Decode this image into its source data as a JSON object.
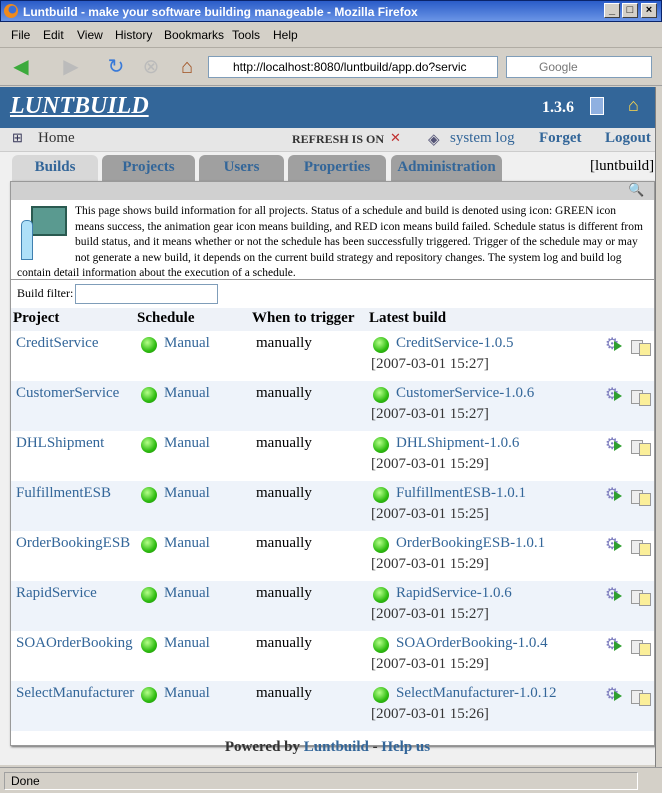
{
  "window": {
    "title": "Luntbuild - make your software building manageable - Mozilla Firefox"
  },
  "menu": [
    "File",
    "Edit",
    "View",
    "History",
    "Bookmarks",
    "Tools",
    "Help"
  ],
  "toolbar": {
    "url": "http://localhost:8080/luntbuild/app.do?servic",
    "search_placeholder": "Google"
  },
  "header": {
    "logo": "LUNTBUILD",
    "version": "1.3.6"
  },
  "nav": {
    "home": "Home",
    "refresh": "REFRESH IS ON",
    "system_log": "system log",
    "forget": "Forget",
    "logout": "Logout"
  },
  "tabs": [
    "Builds",
    "Projects",
    "Users",
    "Properties",
    "Administration"
  ],
  "user": "[luntbuild]",
  "info": "This page shows build information for all projects. Status of a schedule and build is denoted using icon: GREEN icon means success, the animation gear icon means building, and RED icon means build failed. Schedule status is different from build status, and it means whether or not the schedule has been successfully triggered. Trigger of the schedule may or may not generate a new build, it depends on the current build strategy and repository changes. The system log and build log contain detail information about the execution of a schedule.",
  "filter": {
    "label": "Build filter:",
    "value": ""
  },
  "columns": [
    "Project",
    "Schedule",
    "When to trigger",
    "Latest build"
  ],
  "rows": [
    {
      "project": "CreditService",
      "schedule": "Manual",
      "trigger": "manually",
      "build": "CreditService-1.0.5",
      "date": "[2007-03-01 15:27]"
    },
    {
      "project": "CustomerService",
      "schedule": "Manual",
      "trigger": "manually",
      "build": "CustomerService-1.0.6",
      "date": "[2007-03-01 15:27]"
    },
    {
      "project": "DHLShipment",
      "schedule": "Manual",
      "trigger": "manually",
      "build": "DHLShipment-1.0.6",
      "date": "[2007-03-01 15:29]"
    },
    {
      "project": "FulfillmentESB",
      "schedule": "Manual",
      "trigger": "manually",
      "build": "FulfillmentESB-1.0.1",
      "date": "[2007-03-01 15:25]"
    },
    {
      "project": "OrderBookingESB",
      "schedule": "Manual",
      "trigger": "manually",
      "build": "OrderBookingESB-1.0.1",
      "date": "[2007-03-01 15:29]"
    },
    {
      "project": "RapidService",
      "schedule": "Manual",
      "trigger": "manually",
      "build": "RapidService-1.0.6",
      "date": "[2007-03-01 15:27]"
    },
    {
      "project": "SOAOrderBooking",
      "schedule": "Manual",
      "trigger": "manually",
      "build": "SOAOrderBooking-1.0.4",
      "date": "[2007-03-01 15:29]"
    },
    {
      "project": "SelectManufacturer",
      "schedule": "Manual",
      "trigger": "manually",
      "build": "SelectManufacturer-1.0.12",
      "date": "[2007-03-01 15:26]"
    }
  ],
  "footer": {
    "powered": "Powered by ",
    "luntbuild": "Luntbuild",
    "sep": " - ",
    "help": "Help us"
  },
  "status": "Done"
}
